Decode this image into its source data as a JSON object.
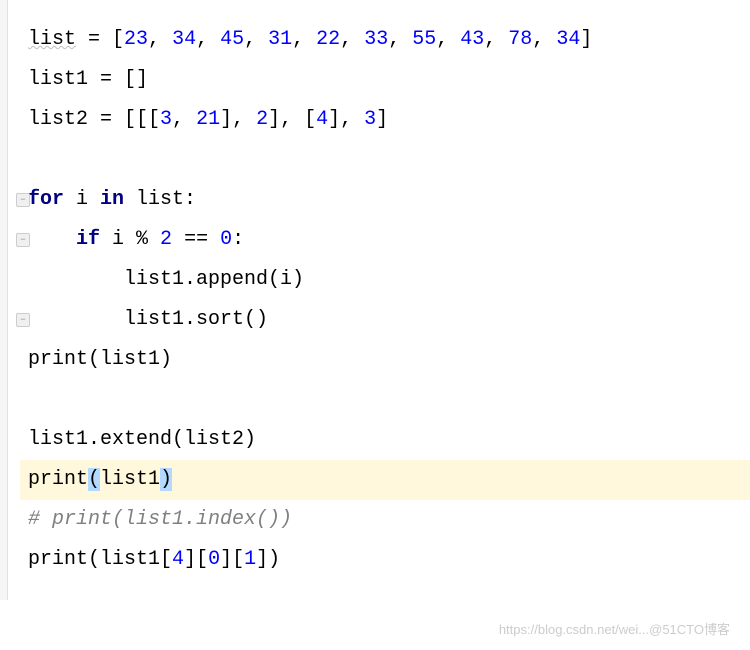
{
  "code": {
    "line1": {
      "var": "list",
      "nums": [
        "23",
        "34",
        "45",
        "31",
        "22",
        "33",
        "55",
        "43",
        "78",
        "34"
      ]
    },
    "line2": "list1 = []",
    "line3": {
      "var": "list2",
      "n1": "3",
      "n2": "21",
      "n3": "2",
      "n4": "4",
      "n5": "3"
    },
    "line4": "",
    "line5": {
      "kw1": "for",
      "v": " i ",
      "kw2": "in",
      "rest": " list:"
    },
    "line6": {
      "indent": "    ",
      "kw": "if",
      "mid": " i % ",
      "n1": "2",
      "eq": " == ",
      "n2": "0",
      "colon": ":"
    },
    "line7": "        list1.append(i)",
    "line8": "        list1.sort()",
    "line9": "print(list1)",
    "line10": "",
    "line11": "list1.extend(list2)",
    "line12": {
      "pre": "print",
      "lp": "(",
      "mid": "list1",
      "rp": ")"
    },
    "line13": "# print(list1.index())",
    "line14": {
      "pre": "print(list1[",
      "n1": "4",
      "b1": "][",
      "n2": "0",
      "b2": "][",
      "n3": "1",
      "end": "])"
    }
  },
  "watermark": "https://blog.csdn.net/wei...@51CTO博客"
}
